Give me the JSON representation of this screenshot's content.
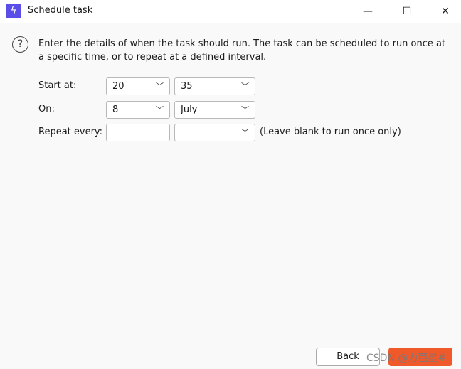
{
  "window": {
    "title": "Schedule task",
    "app_icon": "lightning-icon",
    "controls": [
      "minimize",
      "maximize",
      "close"
    ]
  },
  "intro": "Enter the details of when the task should run. The task can be scheduled to run once at a specific time, or to repeat at a defined interval.",
  "form": {
    "start_label": "Start at:",
    "start_hour": "20",
    "start_minute": "35",
    "on_label": "On:",
    "on_day": "8",
    "on_month": "July",
    "repeat_label": "Repeat every:",
    "repeat_value": "",
    "repeat_unit": "",
    "repeat_note": "(Leave blank to run once only)"
  },
  "buttons": {
    "back": "Back"
  },
  "watermark": "CSDN @力芭星#",
  "colors": {
    "accent": "#f0592a",
    "app_icon": "#5b4ee8"
  }
}
